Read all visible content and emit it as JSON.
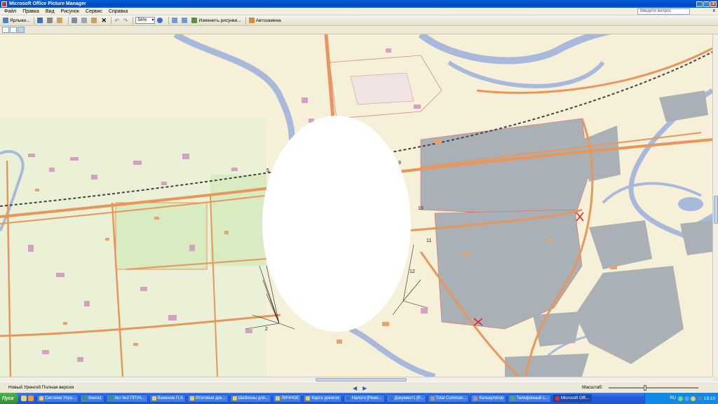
{
  "window": {
    "title": "Microsoft Office Picture Manager",
    "buttons": [
      "_",
      "□",
      "x"
    ]
  },
  "menu": {
    "items": [
      "Файл",
      "Правка",
      "Вид",
      "Рисунок",
      "Сервис",
      "Справка"
    ],
    "ask_placeholder": "Введите вопрос",
    "close_symbol": "x"
  },
  "toolbar": {
    "shortcuts_label": "Ярлыки...",
    "zoom_value": "56%",
    "edit_label": "Изменить рисунки...",
    "autocorrect_label": "Автозамена"
  },
  "map": {
    "labels": [
      "9",
      "10",
      "11",
      "12",
      "2",
      "5"
    ]
  },
  "status": {
    "text": "Новый Уренгой Полная версия",
    "zoom_label": "Масштаб:",
    "zoom_fraction": 0.4
  },
  "taskbar": {
    "start_label": "Пуск",
    "tasks": [
      "Система Упра...",
      "Книга1",
      "Акт №2 ППУА...",
      "Важенов П.А",
      "Итоговые док...",
      "Шаблоны для...",
      "ЛИЧНОЕ",
      "Карта уренгоя",
      "Налоги [Режи...",
      "Документ1 [Р...",
      "Total Comman...",
      "Калькулятор",
      "Телефонный с...",
      "Microsoft Offi..."
    ],
    "clock": "19:10",
    "tray_letters": [
      "RU",
      "N"
    ]
  },
  "colors": {
    "road": "#e8965a",
    "water": "#a9b9dc",
    "industrial": "#a9b1b6",
    "building": "#d6a0c4",
    "park": "#d9ebc1",
    "parcel": "#e6c6c6"
  }
}
